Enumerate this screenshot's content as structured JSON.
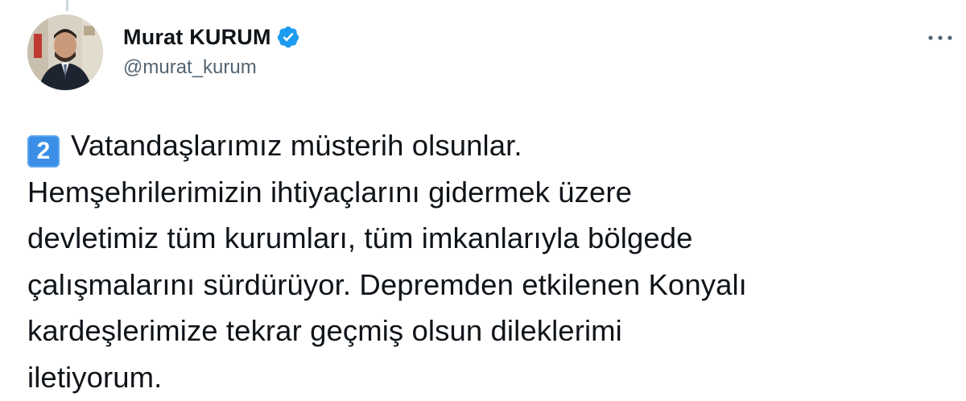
{
  "author": {
    "display_name": "Murat KURUM",
    "handle": "@murat_kurum",
    "verified": true
  },
  "icons": {
    "verified": "verified-badge-icon",
    "more": "more-dots-icon",
    "number_emoji": "keycap-2-emoji"
  },
  "tweet": {
    "keycap": "2",
    "lines": [
      "Vatandaşlarımız müsterih olsunlar.",
      "Hemşehrilerimizin ihtiyaçlarını gidermek üzere",
      "devletimiz tüm kurumları, tüm imkanlarıyla bölgede",
      "çalışmalarını sürdürüyor. Depremden etkilenen Konyalı",
      "kardeşlerimize tekrar geçmiş olsun dileklerimi",
      "iletiyorum."
    ]
  },
  "colors": {
    "verified_blue": "#1d9bf0",
    "keycap_blue": "#3a8ee6",
    "handle_gray": "#536471",
    "text": "#0f1419"
  }
}
